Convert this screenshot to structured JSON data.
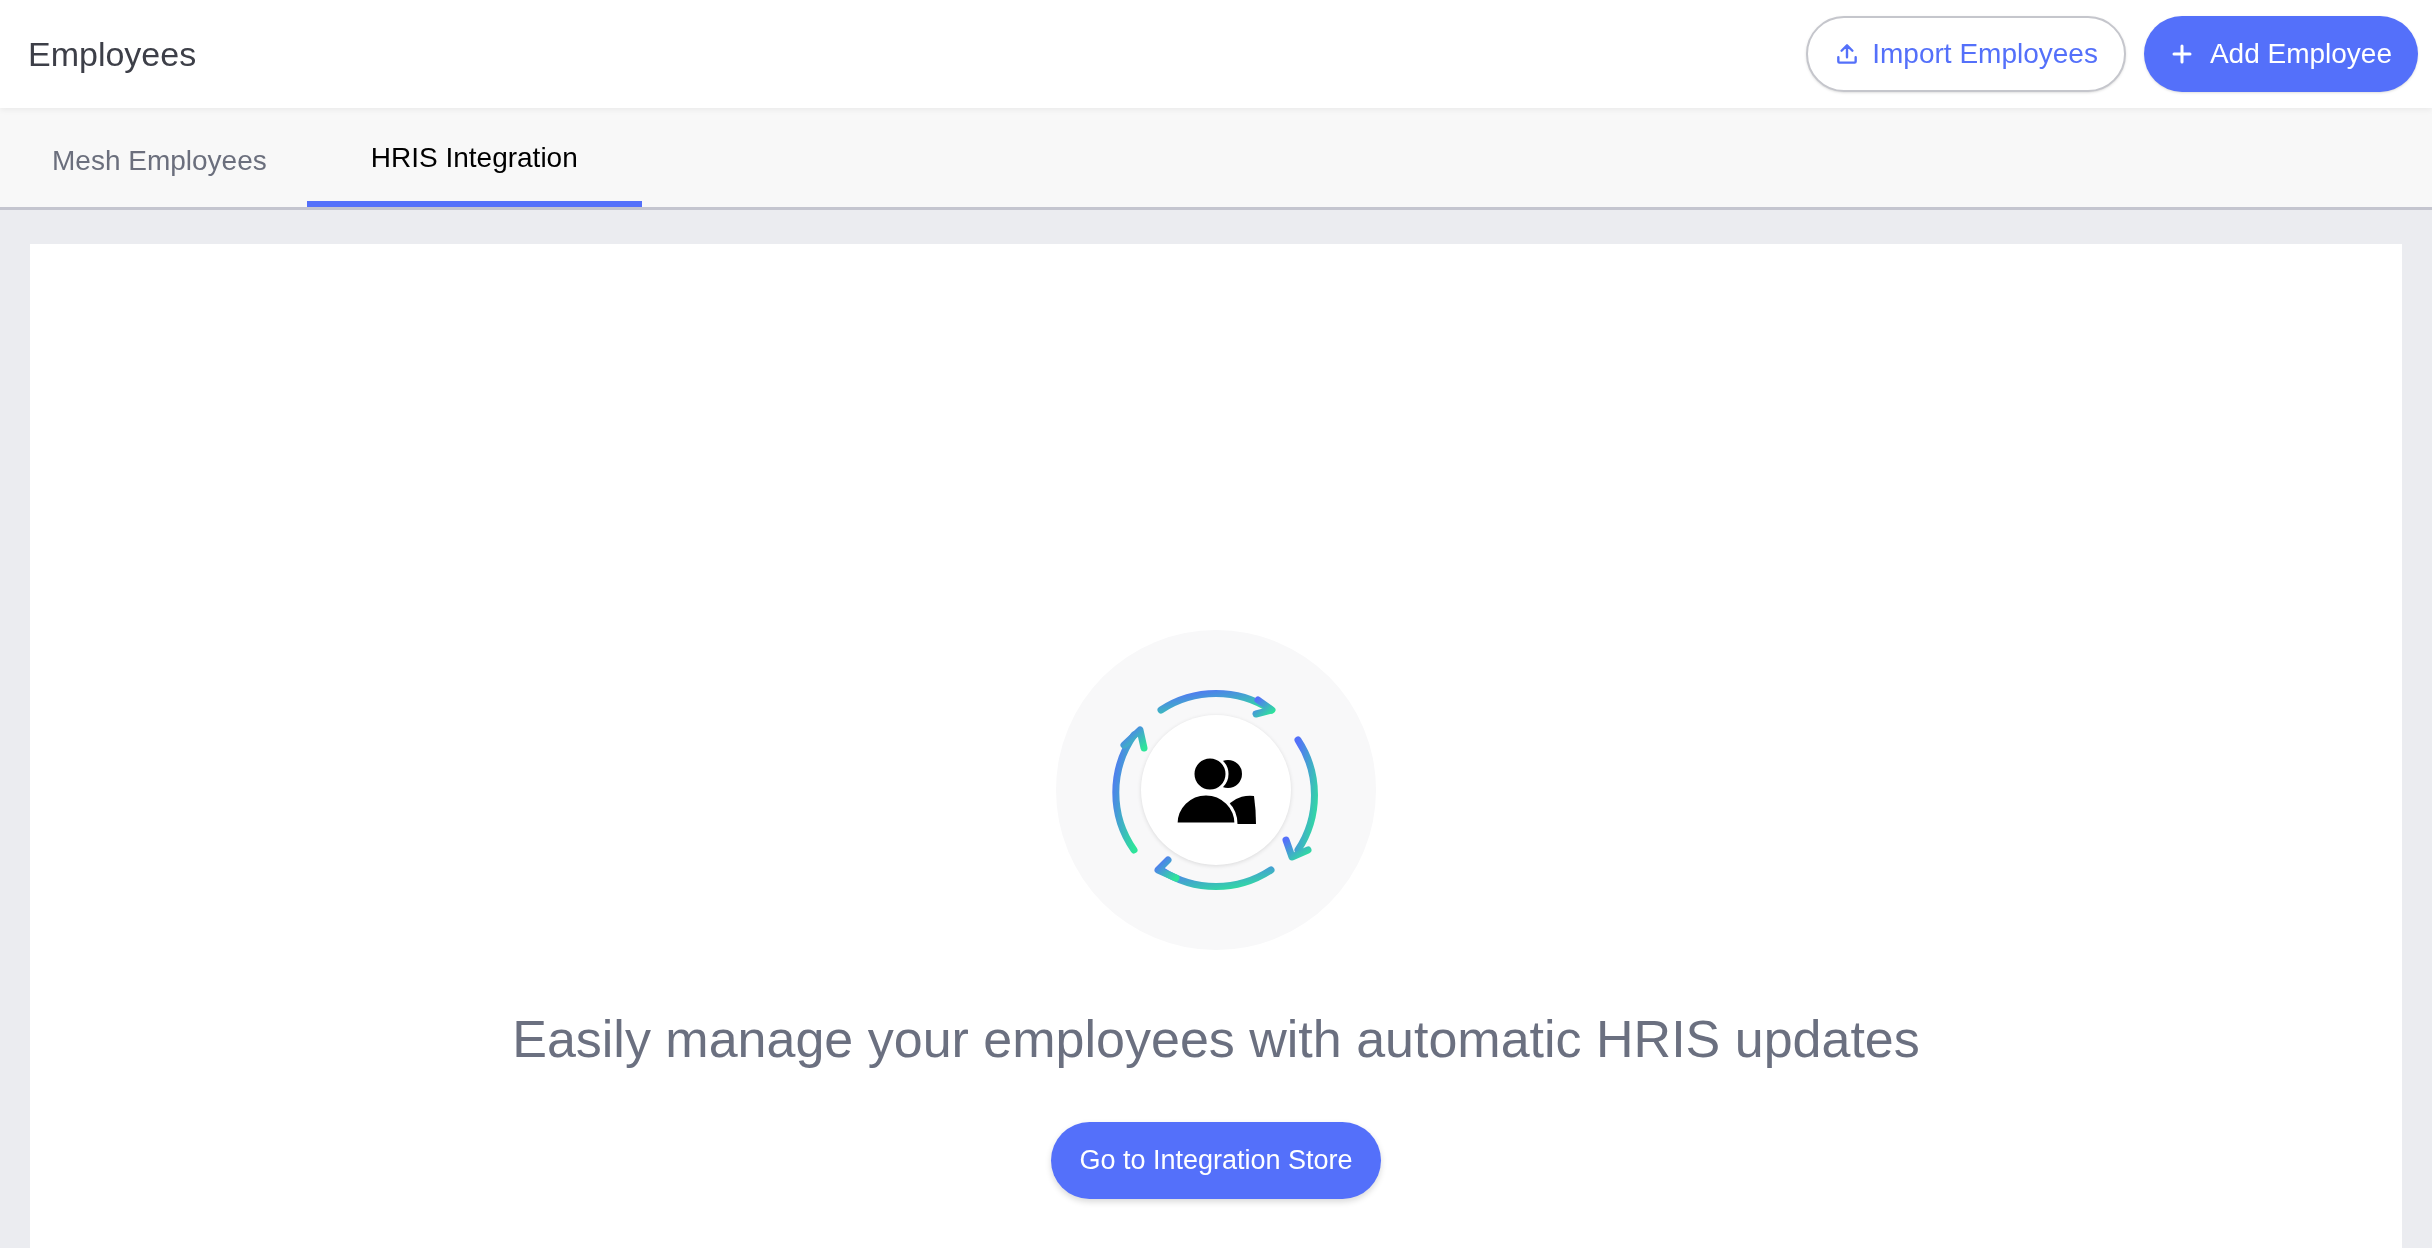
{
  "header": {
    "title": "Employees",
    "buttons": [
      {
        "kind": "outline",
        "label": "Import Employees"
      },
      {
        "kind": "primary",
        "label": "Add Employee"
      }
    ]
  },
  "tabs": [
    {
      "label": "Mesh Employees",
      "selected": false
    },
    {
      "label": "HRIS Integration",
      "selected": true
    }
  ],
  "empty_state": {
    "message": "Easily manage your employees with automatic HRIS updates",
    "button": "Go to Integration Store"
  }
}
